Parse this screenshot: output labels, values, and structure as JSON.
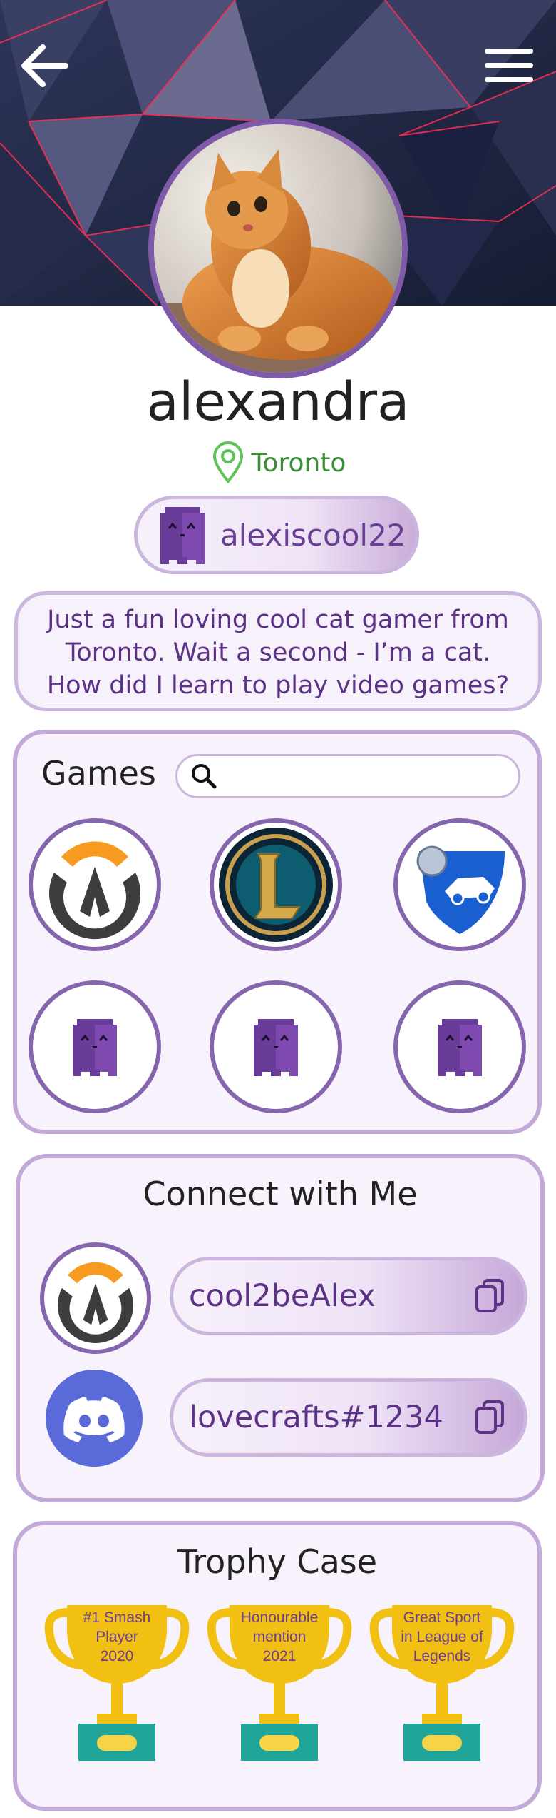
{
  "header": {
    "back_icon": "arrow-left-icon",
    "menu_icon": "hamburger-menu-icon"
  },
  "profile": {
    "username": "alexandra",
    "location": "Toronto",
    "gamertag": "alexiscool22",
    "bio": "Just a fun loving cool cat gamer from Toronto. Wait a second - I’m a cat. How did I learn to play video games?"
  },
  "games": {
    "title": "Games",
    "search_placeholder": "",
    "items": [
      {
        "icon": "overwatch-logo-icon"
      },
      {
        "icon": "league-of-legends-logo-icon"
      },
      {
        "icon": "rocket-league-logo-icon"
      },
      {
        "icon": "ghost-placeholder-icon"
      },
      {
        "icon": "ghost-placeholder-icon"
      },
      {
        "icon": "ghost-placeholder-icon"
      }
    ]
  },
  "connect": {
    "title": "Connect with Me",
    "items": [
      {
        "platform_icon": "overwatch-logo-icon",
        "handle": "cool2beAlex"
      },
      {
        "platform_icon": "discord-logo-icon",
        "handle": "lovecrafts#1234"
      }
    ]
  },
  "trophies": {
    "title": "Trophy Case",
    "items": [
      {
        "line1": "#1 Smash",
        "line2": "Player",
        "line3": "2020"
      },
      {
        "line1": "Honourable",
        "line2": "mention",
        "line3": "2021"
      },
      {
        "line1": "Great Sport",
        "line2": "in League of",
        "line3": "Legends"
      }
    ]
  },
  "colors": {
    "accent_purple": "#7f5aa8",
    "light_purple": "#cbb6de",
    "text_purple": "#5c3286",
    "location_green": "#3a8f36",
    "trophy_gold": "#f2c012",
    "trophy_base": "#1fa59a"
  }
}
